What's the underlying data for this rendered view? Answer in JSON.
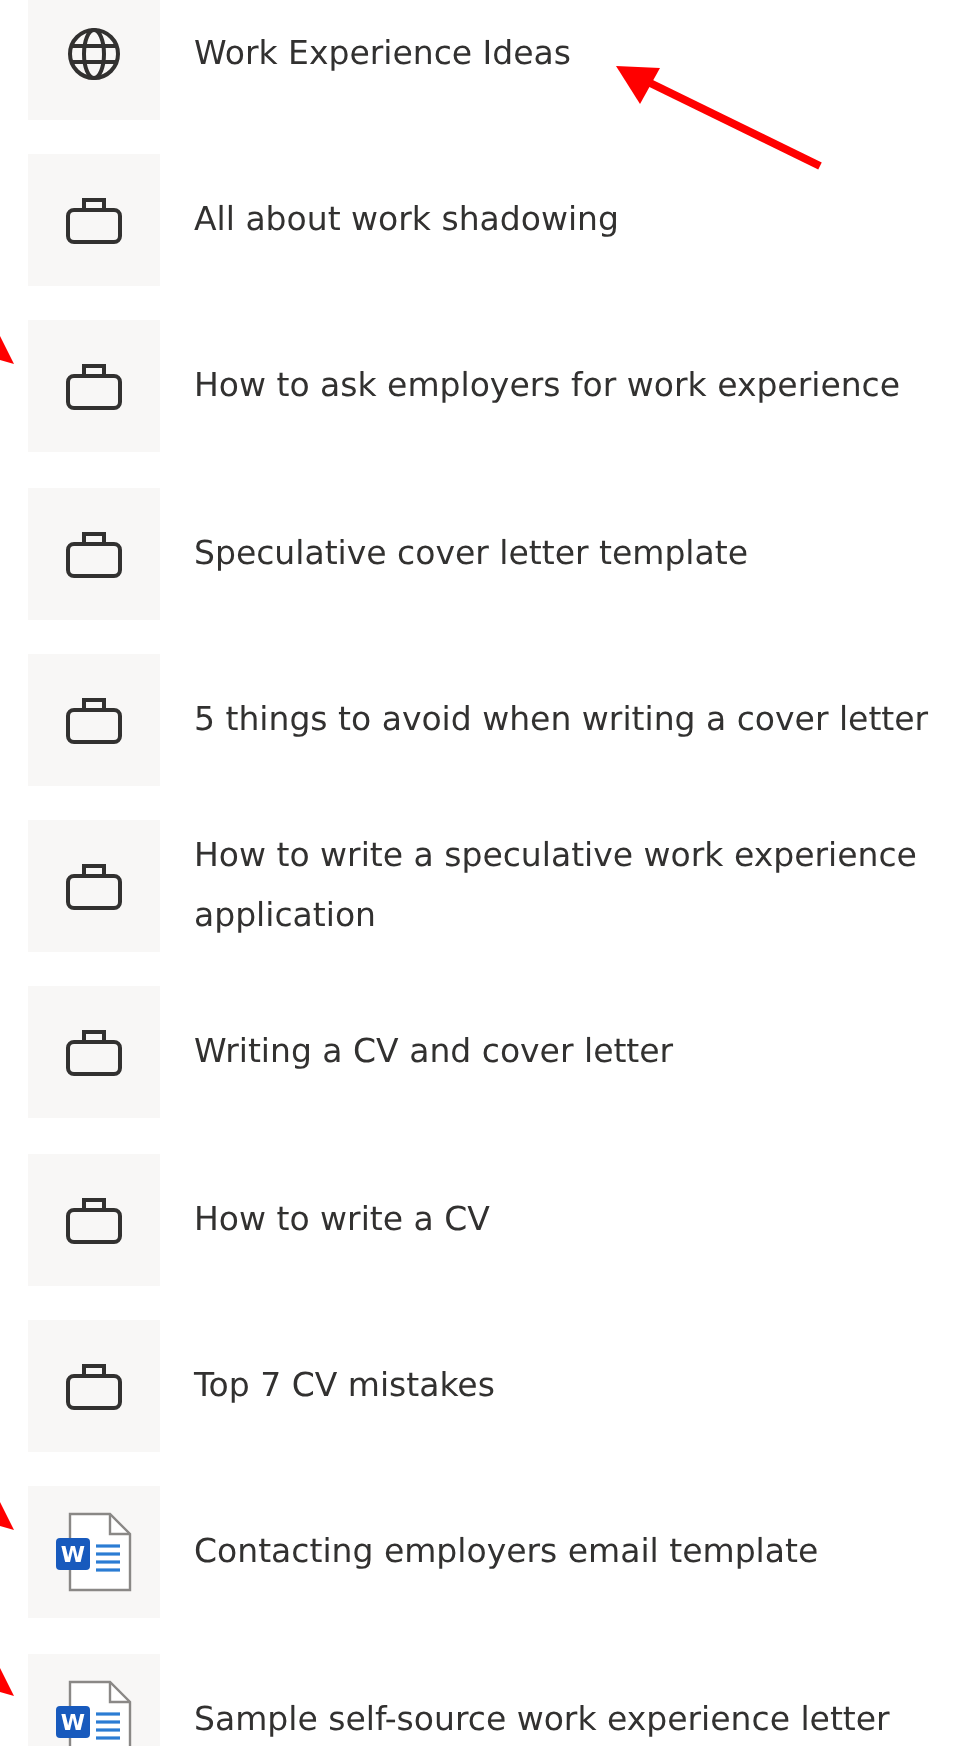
{
  "items": [
    {
      "title": "Work Experience Ideas",
      "kind": "globe",
      "marked": true
    },
    {
      "title": "All about work shadowing",
      "kind": "briefcase",
      "marked": false
    },
    {
      "title": "How to ask employers for work experience",
      "kind": "briefcase",
      "marked": true
    },
    {
      "title": "Speculative cover letter template",
      "kind": "briefcase",
      "marked": false
    },
    {
      "title": "5 things to avoid when writing a cover letter",
      "kind": "briefcase",
      "marked": false
    },
    {
      "title": "How to write a speculative work experience application",
      "kind": "briefcase",
      "marked": false
    },
    {
      "title": "Writing a CV and cover letter",
      "kind": "briefcase",
      "marked": false
    },
    {
      "title": "How to write a CV",
      "kind": "briefcase",
      "marked": false
    },
    {
      "title": "Top 7 CV mistakes",
      "kind": "briefcase",
      "marked": false
    },
    {
      "title": "Contacting employers email template",
      "kind": "word",
      "badge": "W",
      "marked": true
    },
    {
      "title": "Sample self-source work experience letter",
      "kind": "word",
      "badge": "W",
      "marked": true
    }
  ]
}
